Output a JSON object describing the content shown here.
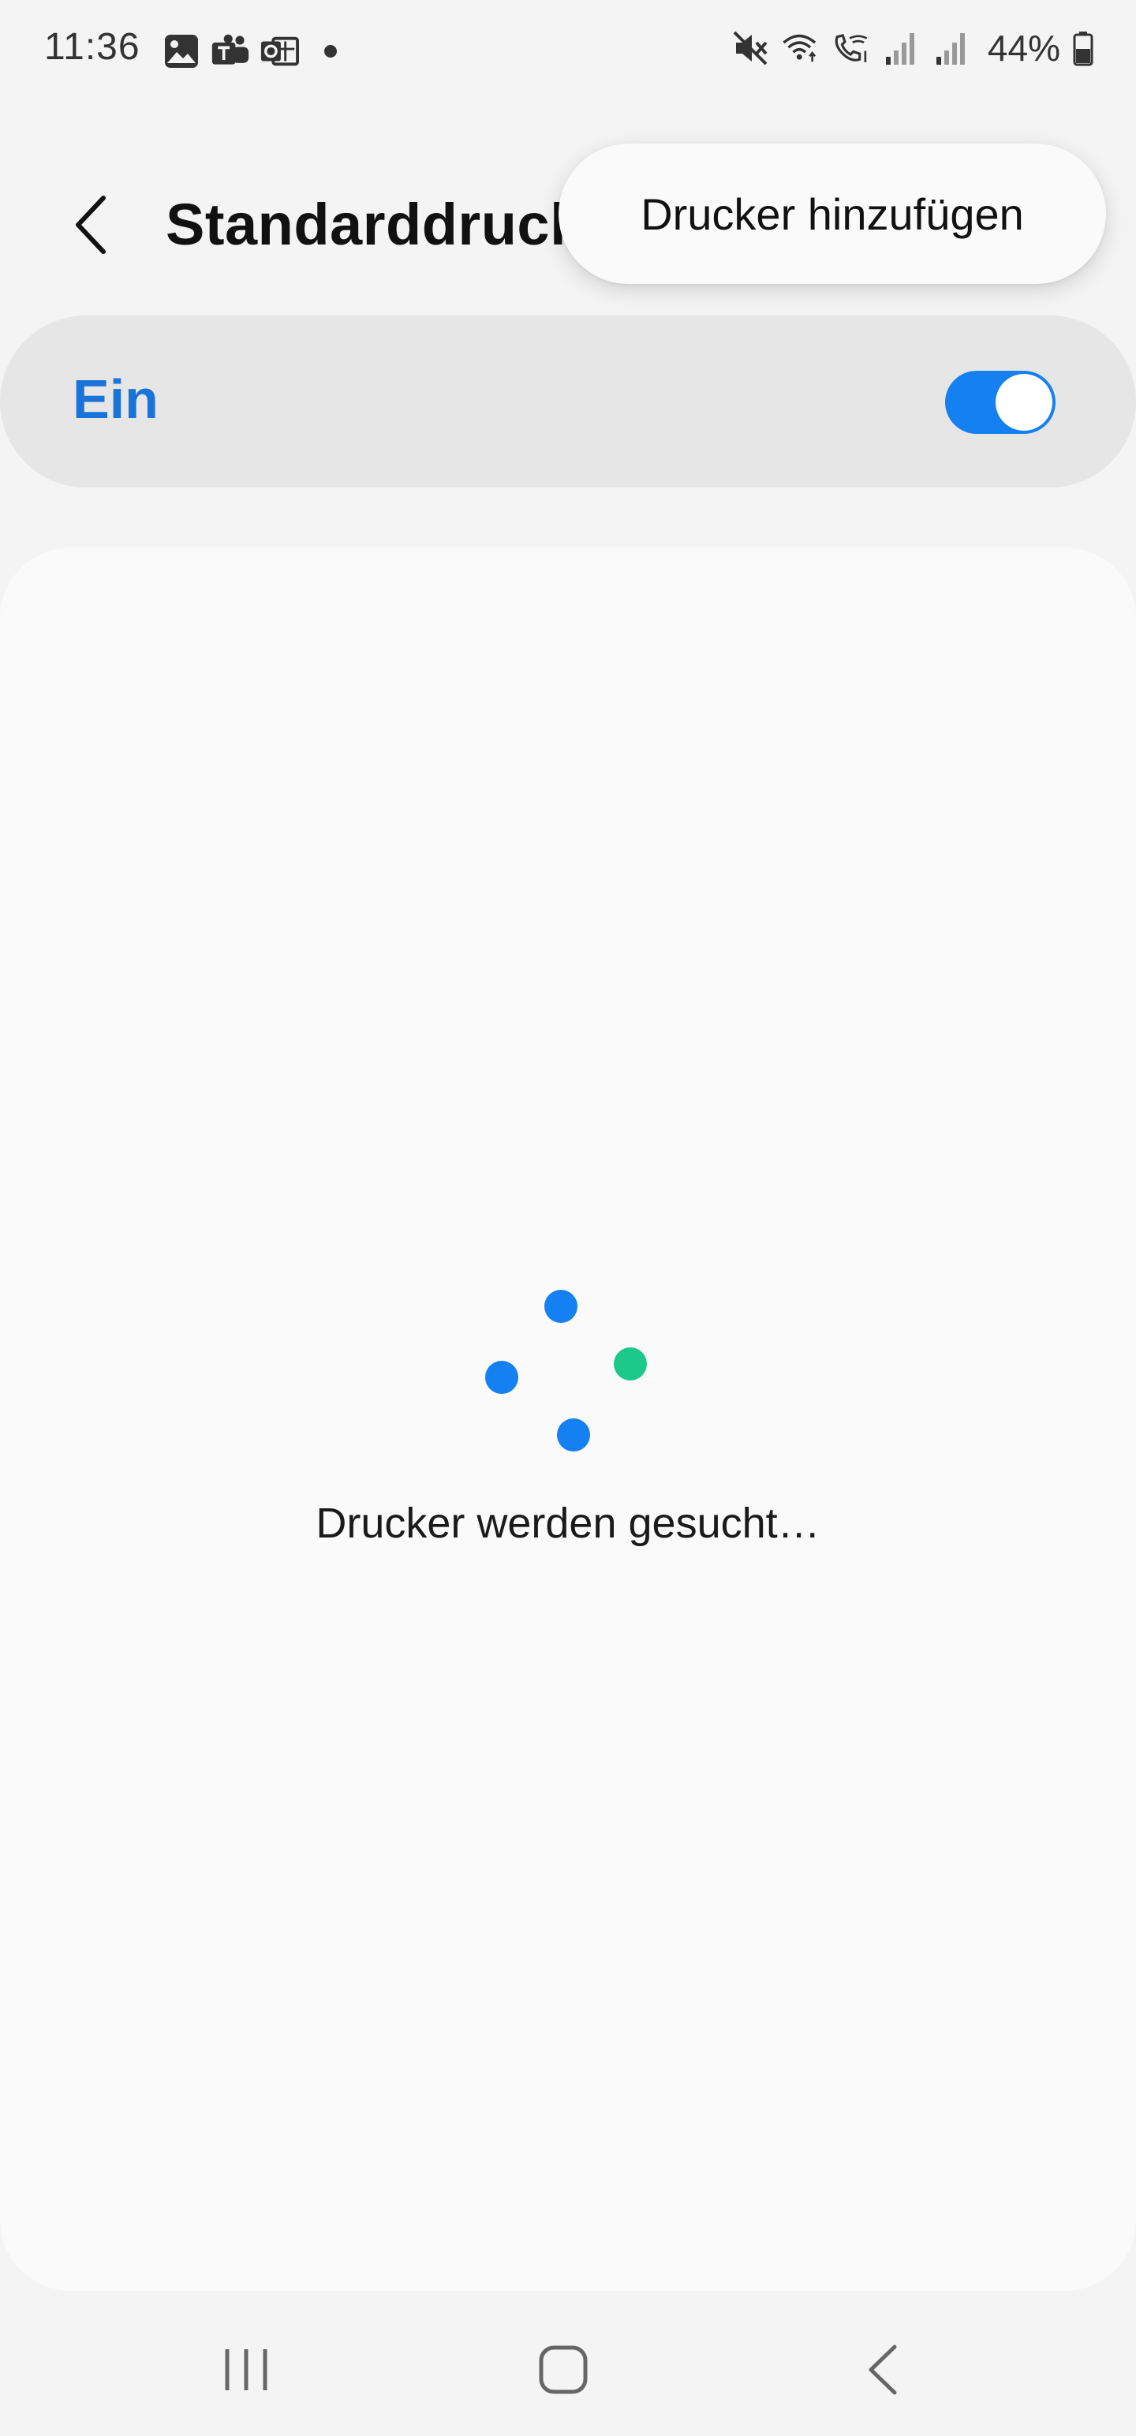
{
  "status_bar": {
    "time": "11:36",
    "left_icons": [
      "gallery-icon",
      "teams-icon",
      "outlook-icon",
      "notification-dot-icon"
    ],
    "right_icons": [
      "mute-icon",
      "wifi-icon",
      "wifi-calling-icon",
      "signal-icon",
      "signal-icon-2",
      "battery-icon"
    ],
    "battery": "44%"
  },
  "header": {
    "title": "Standarddruck",
    "back_icon": "chevron-left-icon"
  },
  "popup_menu": {
    "items": [
      {
        "label": "Drucker hinzufügen"
      }
    ]
  },
  "toggle": {
    "label": "Ein",
    "state": "on",
    "accent_color": "#1580f2"
  },
  "content": {
    "status_text": "Drucker werden gesucht…",
    "loader_colors": [
      "#1580f2",
      "#1cc98a"
    ]
  },
  "nav_bar": {
    "recents_icon": "recents-icon",
    "home_icon": "home-icon",
    "back_icon": "back-icon"
  }
}
